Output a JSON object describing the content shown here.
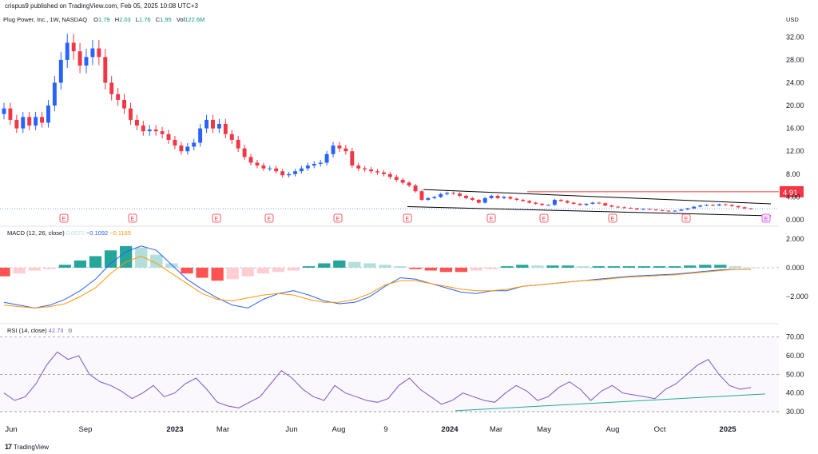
{
  "header": {
    "publish_text": "crispus9 published on TradingView.com, Feb 05, 2025 10:08 UTC+3"
  },
  "legend": {
    "symbol": "Plug Power, Inc., 1W, NASDAQ",
    "o_label": "O",
    "o_value": "1.79",
    "h_label": "H",
    "h_value": "2.03",
    "l_label": "L",
    "l_value": "1.76",
    "c_label": "C",
    "c_value": "1.95",
    "vol_label": "Vol",
    "vol_value": "122.6M"
  },
  "currency": "USD",
  "macd_legend": {
    "name": "MACD (12, 26, close)",
    "hist": "0.0072",
    "macd": "−0.1092",
    "signal": "−0.1165"
  },
  "rsi_legend": {
    "name": "RSI (14, close)",
    "value": "42.73"
  },
  "footer": {
    "brand": "TradingView",
    "logo": "17"
  },
  "colors": {
    "up": "#2962ff",
    "down": "#f23645",
    "macd_line": "#2962ff",
    "signal_line": "#ff9800",
    "hist_up_strong": "#26a69a",
    "hist_up_weak": "#b2dfdb",
    "hist_down_strong": "#ff5252",
    "hist_down_weak": "#ffcdd2",
    "rsi": "#7e57c2",
    "trend": "#22ab94",
    "price_line": "#f23645",
    "earnings": "#f23645",
    "earnings_next": "#e040fb"
  },
  "chart_data": [
    {
      "type": "candlestick",
      "title": "Plug Power, Inc., 1W, NASDAQ",
      "ylabel": "USD",
      "ylim": [
        0,
        34
      ],
      "y_ticks": [
        "32.00",
        "28.00",
        "24.00",
        "20.00",
        "16.00",
        "12.00",
        "8.00",
        "4.00",
        "0.000"
      ],
      "x_tick_labels": [
        "Jun",
        "Sep",
        "2023",
        "Mar",
        "Jun",
        "Aug",
        "9",
        "2024",
        "Mar",
        "May",
        "Aug",
        "Oct",
        "2025"
      ],
      "last_price_label": "1.95",
      "price_line": {
        "value": 4.91,
        "label": "4.91"
      },
      "closes": [
        19.5,
        17.5,
        16.0,
        18.0,
        16.5,
        18.0,
        17.0,
        20.0,
        24.0,
        28.0,
        31.0,
        29.5,
        27.0,
        28.5,
        30.0,
        28.5,
        24.0,
        22.0,
        21.0,
        19.5,
        17.5,
        16.5,
        15.5,
        15.8,
        15.5,
        15.0,
        14.0,
        13.0,
        12.0,
        12.8,
        13.5,
        16.0,
        17.5,
        16.0,
        16.8,
        15.0,
        14.0,
        12.5,
        11.0,
        10.0,
        9.5,
        9.0,
        9.0,
        8.5,
        7.8,
        8.0,
        8.5,
        9.0,
        9.5,
        9.8,
        10.0,
        11.5,
        13.0,
        12.5,
        12.0,
        9.5,
        9.0,
        8.8,
        8.5,
        8.3,
        8.0,
        7.5,
        7.0,
        6.5,
        6.0,
        5.0,
        3.5,
        3.8,
        4.0,
        4.5,
        4.7,
        4.6,
        4.2,
        3.8,
        3.5,
        3.0,
        3.8,
        4.2,
        3.8,
        4.0,
        3.7,
        3.5,
        3.3,
        3.0,
        2.8,
        2.6,
        2.6,
        3.5,
        3.3,
        3.0,
        2.8,
        2.6,
        2.8,
        3.0,
        2.9,
        2.5,
        2.3,
        2.2,
        2.1,
        2.0,
        1.8,
        1.9,
        1.8,
        1.7,
        1.6,
        1.5,
        1.6,
        1.8,
        2.0,
        2.3,
        2.5,
        2.6,
        2.5,
        2.7,
        2.6,
        2.4,
        2.2,
        2.0,
        1.95
      ],
      "earnings_marks": [
        "E",
        "E",
        "E",
        "E",
        "E",
        "E",
        "E",
        "E",
        "E",
        "E",
        "E",
        "E"
      ]
    },
    {
      "type": "line",
      "title": "MACD (12, 26, close)",
      "ylim": [
        -3.5,
        2.6
      ],
      "y_ticks": [
        "2.000",
        "0.000",
        "−2.000"
      ],
      "series": [
        {
          "name": "MACD",
          "values": [
            -2.4,
            -2.6,
            -2.8,
            -2.6,
            -2.2,
            -1.6,
            -0.8,
            0.3,
            1.1,
            1.5,
            1.2,
            0.2,
            -0.8,
            -1.5,
            -2.1,
            -2.6,
            -2.8,
            -2.2,
            -1.8,
            -1.6,
            -1.9,
            -2.3,
            -2.5,
            -2.4,
            -2.0,
            -1.3,
            -0.7,
            -0.8,
            -1.1,
            -1.4,
            -1.7,
            -1.8,
            -1.6,
            -1.6,
            -1.3,
            -1.2,
            -1.1,
            -1.0,
            -0.9,
            -0.8,
            -0.7,
            -0.6,
            -0.55,
            -0.5,
            -0.45,
            -0.35,
            -0.25,
            -0.15,
            -0.1,
            -0.11
          ]
        },
        {
          "name": "Signal",
          "values": [
            -2.6,
            -2.7,
            -2.8,
            -2.7,
            -2.5,
            -2.0,
            -1.4,
            -0.4,
            0.4,
            0.8,
            0.3,
            -0.4,
            -1.1,
            -1.8,
            -2.2,
            -2.3,
            -2.1,
            -1.9,
            -1.8,
            -1.9,
            -2.2,
            -2.4,
            -2.4,
            -2.2,
            -1.8,
            -1.2,
            -0.9,
            -0.9,
            -1.1,
            -1.3,
            -1.5,
            -1.6,
            -1.6,
            -1.5,
            -1.3,
            -1.2,
            -1.1,
            -1.0,
            -0.9,
            -0.85,
            -0.75,
            -0.65,
            -0.6,
            -0.55,
            -0.5,
            -0.4,
            -0.3,
            -0.2,
            -0.12,
            -0.12
          ]
        },
        {
          "name": "Histogram",
          "values": [
            -0.6,
            -0.4,
            -0.2,
            -0.1,
            0.2,
            0.5,
            0.8,
            1.2,
            1.5,
            1.4,
            0.9,
            0.3,
            -0.4,
            -0.7,
            -0.9,
            -0.8,
            -0.6,
            -0.4,
            -0.3,
            -0.2,
            0.1,
            0.3,
            0.5,
            0.4,
            0.3,
            0.2,
            0.1,
            -0.1,
            -0.2,
            -0.3,
            -0.3,
            -0.2,
            -0.1,
            0.1,
            0.2,
            0.15,
            0.15,
            0.15,
            0.1,
            0.1,
            0.1,
            0.1,
            0.1,
            0.1,
            0.1,
            0.15,
            0.2,
            0.2,
            0.1,
            0.01
          ]
        }
      ]
    },
    {
      "type": "line",
      "title": "RSI (14, close)",
      "ylim": [
        27,
        75
      ],
      "y_ticks": [
        "70.00",
        "60.00",
        "50.00",
        "40.00",
        "30.00"
      ],
      "bands": [
        70,
        50,
        30
      ],
      "series": [
        {
          "name": "RSI",
          "values": [
            40,
            36,
            38,
            45,
            55,
            62,
            58,
            60,
            50,
            46,
            44,
            41,
            37,
            40,
            44,
            38,
            40,
            45,
            48,
            42,
            35,
            33,
            32,
            35,
            38,
            45,
            52,
            48,
            42,
            38,
            36,
            44,
            40,
            38,
            36,
            35,
            37,
            44,
            48,
            42,
            38,
            34,
            36,
            40,
            38,
            36,
            35,
            40,
            44,
            41,
            36,
            38,
            43,
            46,
            42,
            36,
            41,
            44,
            40,
            39,
            38,
            37,
            42,
            45,
            50,
            55,
            58,
            50,
            44,
            42,
            43
          ]
        },
        {
          "name": "Trend",
          "values": [
            30.5,
            39.5
          ]
        }
      ]
    }
  ]
}
